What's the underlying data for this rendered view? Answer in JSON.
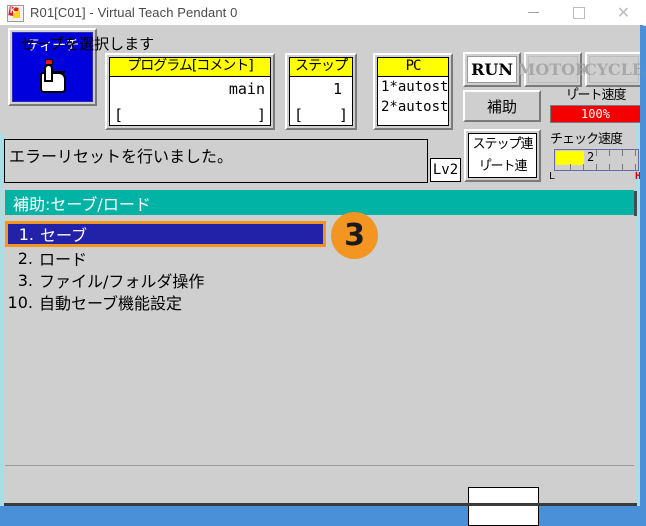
{
  "window": {
    "title": "R01[C01] - Virtual Teach Pendant 0",
    "icon": "app-icon",
    "minimize_label": "—",
    "maximize_label": "□",
    "close_label": "✕"
  },
  "toolbar": {
    "teach": {
      "label": "ティーチ",
      "icon": "hand-pointer-icon",
      "active": true
    },
    "program": {
      "title": "プログラム[コメント]",
      "value": "main",
      "bracket_left": "[",
      "bracket_right": "]"
    },
    "step": {
      "title": "ステップ゚",
      "value": "1",
      "bracket_left": "[",
      "bracket_right": "]"
    },
    "pc": {
      "title": "PC",
      "line1": "1*autost",
      "line2": "2*autost"
    },
    "lamps": [
      {
        "label": "RUN",
        "state": "on"
      },
      {
        "label": "MOTOR",
        "state": "off"
      },
      {
        "label": "CYCLE",
        "state": "off"
      }
    ],
    "aux_button": "補助",
    "repeat_speed": {
      "label": "リ゚ート速度",
      "value": "100%"
    },
    "mode_button": {
      "line1": "ステップ゚連",
      "line2": "リ゚ート連"
    },
    "check_speed": {
      "label": "チェック速度",
      "value": "2",
      "low_label": "L",
      "high_label": "H"
    }
  },
  "message": {
    "text": "エラーリセットを行いました。",
    "level_badge": "Lv2"
  },
  "menu": {
    "header": "補助:セーブ/ロード",
    "items": [
      {
        "num": "1.",
        "label": "セーブ",
        "selected": true
      },
      {
        "num": "2.",
        "label": "ロード",
        "selected": false
      },
      {
        "num": "3.",
        "label": "ファイル/フォルダ操作",
        "selected": false
      },
      {
        "num": "10.",
        "label": "自動セーブ機能設定",
        "selected": false
      }
    ],
    "step_badge": "3"
  },
  "bottom": {
    "hint": "セーブを選択します",
    "input_value": ""
  },
  "colors": {
    "accent_teal": "#00b3a4",
    "selection_blue": "#2222a8",
    "badge_orange": "#f39521",
    "title_yellow": "#ffff00",
    "alert_red": "#f40000",
    "window_bg": "#cfcfcf",
    "desktop_blue": "#4a90d9"
  }
}
